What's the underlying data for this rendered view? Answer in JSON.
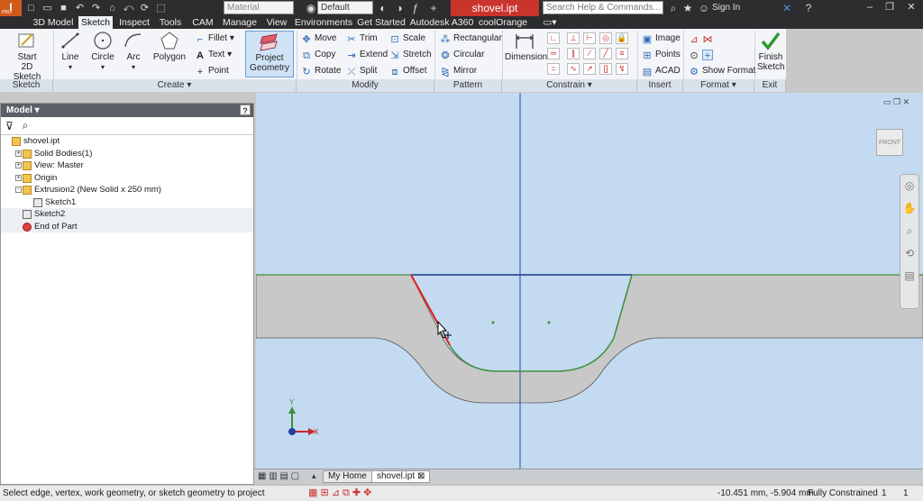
{
  "app": {
    "logo": "I",
    "logo_sub": "PRO"
  },
  "titlebar": {
    "material": "Material",
    "appearance": "Default",
    "document_title": "shovel.ipt",
    "search_placeholder": "Search Help & Commands...",
    "sign_in": "Sign In"
  },
  "tabs": [
    "3D Model",
    "Sketch",
    "Inspect",
    "Tools",
    "CAM",
    "Manage",
    "View",
    "Environments",
    "Get Started",
    "Autodesk A360",
    "coolOrange"
  ],
  "active_tab": "Sketch",
  "ribbon": {
    "panels": [
      "Sketch",
      "Create",
      "Modify",
      "Pattern",
      "Constrain",
      "Insert",
      "Format",
      "Exit"
    ],
    "start_sketch": "Start\n2D Sketch",
    "line": "Line",
    "circle": "Circle",
    "arc": "Arc",
    "polygon": "Polygon",
    "fillet": "Fillet",
    "text": "Text",
    "point": "Point",
    "project_geometry": "Project\nGeometry",
    "move": "Move",
    "copy": "Copy",
    "rotate": "Rotate",
    "trim": "Trim",
    "extend": "Extend",
    "split": "Split",
    "scale": "Scale",
    "stretch": "Stretch",
    "offset": "Offset",
    "rectangular": "Rectangular",
    "circular": "Circular",
    "mirror": "Mirror",
    "dimension": "Dimension",
    "image": "Image",
    "points": "Points",
    "acad": "ACAD",
    "show_format": "Show Format",
    "finish_sketch": "Finish\nSketch"
  },
  "browser": {
    "title": "Model",
    "nodes": [
      {
        "label": "shovel.ipt",
        "level": 0,
        "expander": "",
        "icon": "part-icon"
      },
      {
        "label": "Solid Bodies(1)",
        "level": 1,
        "expander": "+",
        "icon": "solid-bodies-icon"
      },
      {
        "label": "View: Master",
        "level": 1,
        "expander": "+",
        "icon": "view-icon"
      },
      {
        "label": "Origin",
        "level": 1,
        "expander": "+",
        "icon": "folder-icon"
      },
      {
        "label": "Extrusion2 (New Solid x 250 mm)",
        "level": 1,
        "expander": "-",
        "icon": "extrusion-icon"
      },
      {
        "label": "Sketch1",
        "level": 2,
        "expander": "",
        "icon": "sketch-icon"
      },
      {
        "label": "Sketch2",
        "level": 1,
        "expander": "",
        "icon": "sketch-icon"
      },
      {
        "label": "End of Part",
        "level": 1,
        "expander": "",
        "icon": "end-of-part-icon"
      }
    ]
  },
  "viewcube": {
    "face": "FRONT"
  },
  "axes": {
    "x": "X",
    "y": "Y"
  },
  "doc_tabs": [
    "My Home",
    "shovel.ipt"
  ],
  "status": {
    "prompt": "Select edge, vertex, work geometry,  or sketch geometry to project",
    "coords": "-10.451 mm, -5.904 mm",
    "constraint": "Fully Constrained",
    "n1": "1",
    "n2": "1"
  },
  "colors": {
    "accent": "#2f6db5",
    "title_red": "#c9342d",
    "canvas": "#c3daf1",
    "solid": "#c8c8c8",
    "sketch_blue": "#1f3f9e",
    "sketch_green": "#3d8f3d",
    "highlight_red": "#e0201a"
  }
}
